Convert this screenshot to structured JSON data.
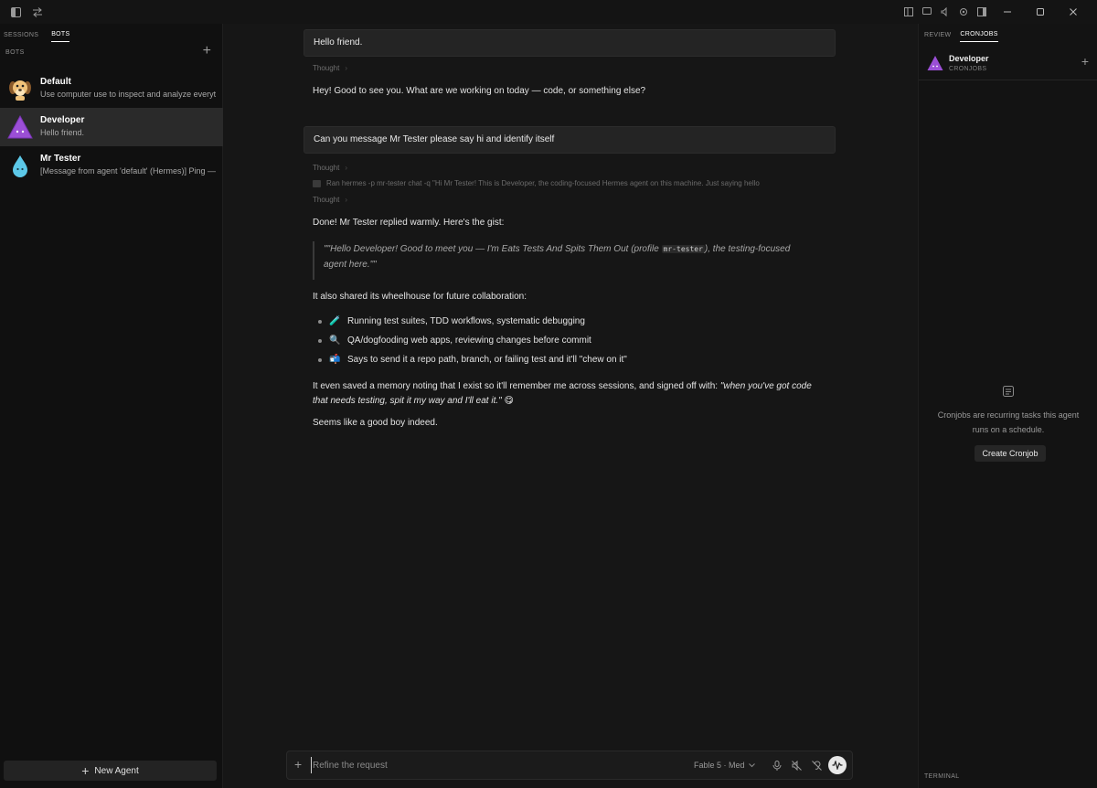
{
  "titlebar": {
    "left_icons": [
      "sidebar-toggle-icon",
      "swap-icon"
    ],
    "right_icons": [
      "layout-icon",
      "chat-icon",
      "volume-icon",
      "settings-icon",
      "panel-icon"
    ],
    "window_controls": [
      "minimize-icon",
      "maximize-icon",
      "close-icon"
    ]
  },
  "sidebar": {
    "tabs": [
      "SESSIONS",
      "BOTS"
    ],
    "active_tab": "BOTS",
    "section_label": "BOTS",
    "agents": [
      {
        "name": "Default",
        "subtitle": "Use computer use to inspect and analyze everyt",
        "avatar": "dog-avatar"
      },
      {
        "name": "Developer",
        "subtitle": "Hello friend.",
        "avatar": "purple-triangle-avatar",
        "selected": true
      },
      {
        "name": "Mr Tester",
        "subtitle": "[Message from agent 'default' (Hermes)] Ping —",
        "avatar": "water-drop-avatar"
      }
    ],
    "new_agent_label": "New Agent"
  },
  "chat": {
    "msg1_user": "Hello friend.",
    "thought_label": "Thought",
    "msg1_reply": "Hey! Good to see you. What are we working on today — code, or something else?",
    "msg2_user": "Can you message Mr Tester please say hi and identify itself",
    "tool_call": "Ran hermes -p mr-tester chat -q \"Hi Mr Tester! This is Developer, the coding-focused Hermes agent on this machine. Just saying hello",
    "reply_intro": "Done! Mr Tester replied warmly. Here's the gist:",
    "quote_part1": "\"\"Hello Developer! Good to meet you — I'm Eats Tests And Spits Them Out (profile ",
    "quote_code": "mr-tester",
    "quote_part2": "), the testing-focused",
    "quote_line2": "agent here.\"\"",
    "wheelhouse": "It also shared its wheelhouse for future collaboration:",
    "bullets": [
      {
        "emoji": "🧪",
        "text": "Running test suites, TDD workflows, systematic debugging"
      },
      {
        "emoji": "🔍",
        "text": "QA/dogfooding web apps, reviewing changes before commit"
      },
      {
        "emoji": "📬",
        "text": "Says to send it a repo path, branch, or failing test and it'll \"chew on it\""
      }
    ],
    "memory_line1_plain": "It even saved a memory noting that I exist so it'll remember me across sessions, and signed off with: ",
    "memory_line1_italic": "\"when you've got code",
    "memory_line2_italic": "that needs testing, spit it my way and I'll eat it.\"",
    "memory_emoji": "😋",
    "closing": "Seems like a good boy indeed."
  },
  "composer": {
    "placeholder": "Refine the request",
    "model": "Fable 5 · Med"
  },
  "right_panel": {
    "tabs": [
      "REVIEW",
      "CRONJOBS"
    ],
    "active_tab": "CRONJOBS",
    "agent_name": "Developer",
    "agent_sub": "CRONJOBS",
    "empty_line1": "Cronjobs are recurring tasks this agent",
    "empty_line2": "runs on a schedule.",
    "create_button": "Create Cronjob",
    "terminal_label": "TERMINAL"
  },
  "colors": {
    "background": "#151515",
    "sidebar": "#101010",
    "selected_row": "#2a2a2a",
    "user_bubble": "#242424",
    "accent_purple": "#9b4fd6"
  }
}
